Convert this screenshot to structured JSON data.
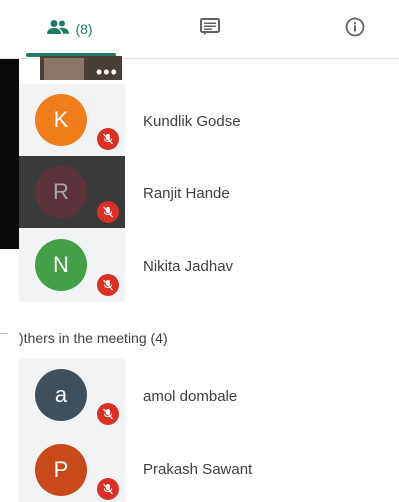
{
  "tabs": {
    "people_count": "(8)",
    "active_color": "#1f7a66"
  },
  "participants": [
    {
      "initial": "K",
      "name": "Kundlik Godse",
      "color": "#f07f1b"
    },
    {
      "initial": "R",
      "name": "Ranjit Hande",
      "color": "#7b2d3b"
    },
    {
      "initial": "N",
      "name": "Nikita Jadhav",
      "color": "#43a047"
    }
  ],
  "others": {
    "title": ")thers in the meeting (4)",
    "people": [
      {
        "initial": "a",
        "name": "amol dombale",
        "color": "#3f4f5c"
      },
      {
        "initial": "P",
        "name": "Prakash Sawant",
        "color": "#c84a1b"
      }
    ]
  },
  "icons": {
    "people": "people-icon",
    "chat": "chat-icon",
    "info": "info-icon",
    "mic_off": "mic-off-icon",
    "more": "more-icon"
  }
}
